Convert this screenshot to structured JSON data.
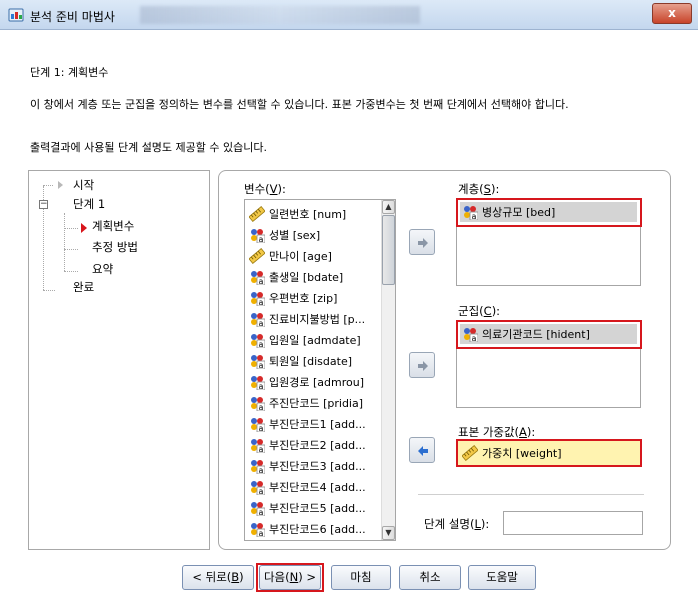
{
  "window": {
    "title": "분석 준비 마법사",
    "close_label": "x"
  },
  "step_title": "단계 1: 계획변수",
  "description_line1": "이 창에서 계층 또는 군집을 정의하는 변수를 선택할 수 있습니다. 표본 가중변수는 첫 번째 단계에서 선택해야 합니다.",
  "description_line2": "출력결과에 사용될 단계 설명도 제공할 수 있습니다.",
  "tree": {
    "start": "시작",
    "step1": "단계 1",
    "planning_vars": "계획변수",
    "estimation": "추정 방법",
    "summary": "요약",
    "finish": "완료"
  },
  "variables_label": {
    "text": "변수(",
    "key": "V",
    "end": "):"
  },
  "variables": [
    {
      "label": "일련번호 [num]",
      "icon": "scale-ruler-icon"
    },
    {
      "label": "성별 [sex]",
      "icon": "nominal-variable-icon"
    },
    {
      "label": "만나이 [age]",
      "icon": "scale-ruler-icon"
    },
    {
      "label": "출생일 [bdate]",
      "icon": "nominal-variable-icon"
    },
    {
      "label": "우편번호 [zip]",
      "icon": "nominal-variable-icon"
    },
    {
      "label": "진료비지불방법 [p...",
      "icon": "nominal-variable-icon"
    },
    {
      "label": "입원일 [admdate]",
      "icon": "nominal-variable-icon"
    },
    {
      "label": "퇴원일 [disdate]",
      "icon": "nominal-variable-icon"
    },
    {
      "label": "입원경로 [admrou]",
      "icon": "nominal-variable-icon"
    },
    {
      "label": "주진단코드 [pridia]",
      "icon": "nominal-variable-icon"
    },
    {
      "label": "부진단코드1 [add...",
      "icon": "nominal-variable-icon"
    },
    {
      "label": "부진단코드2 [add...",
      "icon": "nominal-variable-icon"
    },
    {
      "label": "부진단코드3 [add...",
      "icon": "nominal-variable-icon"
    },
    {
      "label": "부진단코드4 [add...",
      "icon": "nominal-variable-icon"
    },
    {
      "label": "부진단코드5 [add...",
      "icon": "nominal-variable-icon"
    },
    {
      "label": "부진단코드6 [add...",
      "icon": "nominal-variable-icon"
    }
  ],
  "strata": {
    "label": {
      "text": "계층(",
      "key": "S",
      "end": "):"
    },
    "value": "병상규모 [bed]"
  },
  "clusters": {
    "label": {
      "text": "군집(",
      "key": "C",
      "end": "):"
    },
    "value": "의료기관코드 [hident]"
  },
  "sample_weight": {
    "label": {
      "text": "표본 가중값(",
      "key": "A",
      "end": "):"
    },
    "value": "가중치 [weight]"
  },
  "step_description": {
    "label": {
      "text": "단계 설명(",
      "key": "L",
      "end": "):"
    },
    "value": ""
  },
  "buttons": {
    "back": {
      "text": "< 뒤로(",
      "key": "B",
      "end": ")"
    },
    "next": {
      "text": "다음(",
      "key": "N",
      "end": ") >"
    },
    "finish": "마침",
    "cancel": "취소",
    "help": "도움말"
  },
  "colors": {
    "highlight_red": "#d6171d",
    "weight_fill": "#fff3b0",
    "selected_gray": "#d4d4d4"
  }
}
